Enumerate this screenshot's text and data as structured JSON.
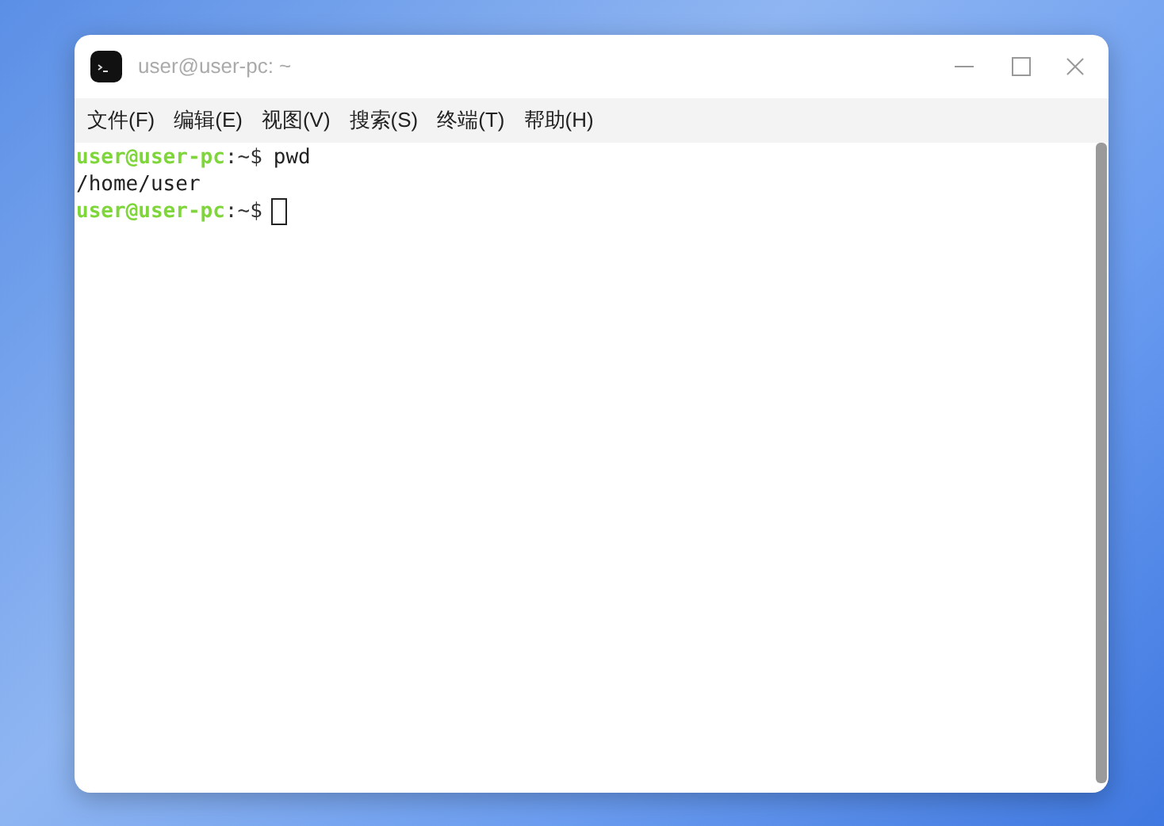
{
  "window": {
    "title": "user@user-pc: ~"
  },
  "menu": [
    "文件(F)",
    "编辑(E)",
    "视图(V)",
    "搜索(S)",
    "终端(T)",
    "帮助(H)"
  ],
  "terminal": {
    "lines": [
      {
        "kind": "prompt",
        "user_host": "user@user-pc",
        "path": ":~$",
        "command": "pwd"
      },
      {
        "kind": "output",
        "text": "/home/user"
      },
      {
        "kind": "prompt",
        "user_host": "user@user-pc",
        "path": ":~$",
        "cursor": true
      }
    ]
  }
}
